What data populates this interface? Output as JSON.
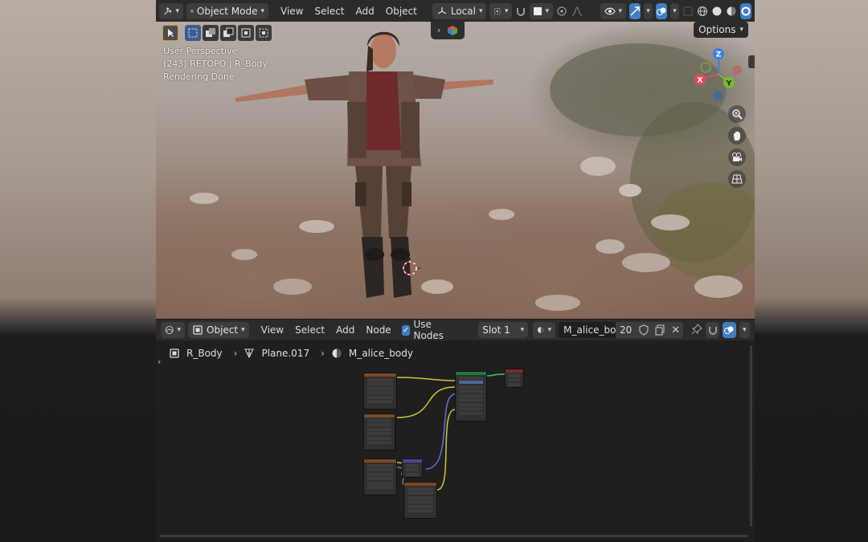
{
  "viewport_header": {
    "mode_label": "Object Mode",
    "menus": [
      "View",
      "Select",
      "Add",
      "Object"
    ],
    "transform_orientation": "Local",
    "options_label": "Options"
  },
  "viewport_overlay": {
    "line1": "User Perspective",
    "line2": "(243) RETOPO | R_Body",
    "line3": "Rendering Done"
  },
  "gizmo": {
    "x_label": "X",
    "y_label": "Y",
    "z_label": "Z"
  },
  "node_header": {
    "object_label": "Object",
    "menus": [
      "View",
      "Select",
      "Add",
      "Node"
    ],
    "use_nodes_label": "Use Nodes",
    "slot_label": "Slot 1",
    "material_name": "M_alice_body",
    "user_count": "20"
  },
  "breadcrumb": {
    "object": "R_Body",
    "mesh": "Plane.017",
    "material": "M_alice_body"
  },
  "colors": {
    "accent_blue": "#3f7ec3",
    "axis_x": "#e04a5a",
    "axis_y": "#7ab92e",
    "axis_z": "#3c80e0",
    "node_image_header": "#7a4a22",
    "node_bsdf_header": "#1f7a3a",
    "node_output_header": "#7a2a2a",
    "node_normal_header": "#4a47a0",
    "wire_yellow": "#c8c83a",
    "wire_purple": "#6b6bd6",
    "wire_green": "#3ac85a",
    "wire_grey": "#a0a0a0"
  },
  "icons": {
    "editor_type": "transform-gizmo-icon",
    "select_box": "select-box-icon",
    "node_editor_type": "shader-editor-icon",
    "pin": "pin-icon",
    "zoom": "zoom-icon",
    "hand": "pan-hand-icon",
    "camera": "camera-icon",
    "grid": "ortho-grid-icon"
  }
}
